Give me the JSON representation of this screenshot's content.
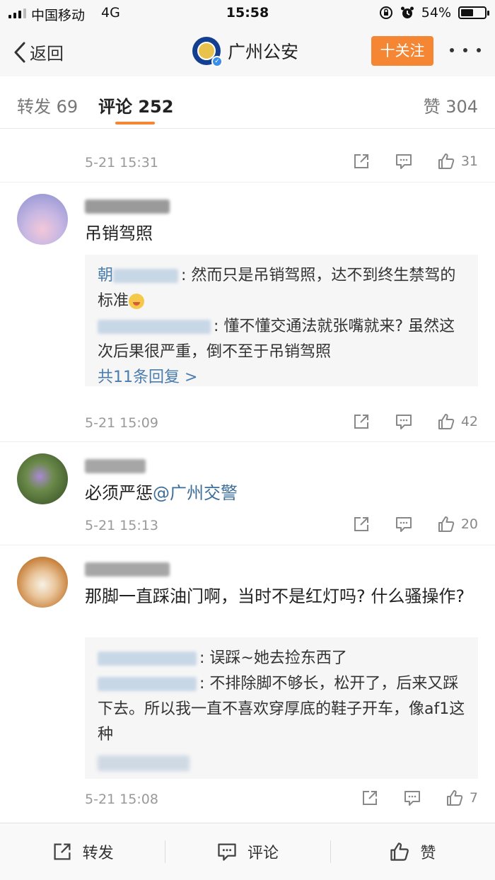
{
  "status_bar": {
    "carrier": "中国移动",
    "network": "4G",
    "time": "15:58",
    "battery": "54%",
    "battery_level": 0.54
  },
  "header": {
    "back_label": "返回",
    "account_name": "广州公安",
    "follow_label": "十关注"
  },
  "tabs": {
    "repost": "转发 69",
    "comments": "评论 252",
    "likes": "赞 304"
  },
  "comments": [
    {
      "time": "5-21 15:31",
      "likes": "31"
    },
    {
      "text": "吊销驾照",
      "replies": [
        {
          "name": "朝",
          "text": ": 然而只是吊销驾照，达不到终生禁驾的标准"
        },
        {
          "text": ": 懂不懂交通法就张嘴就来? 虽然这次后果很严重，倒不至于吊销驾照"
        }
      ],
      "more_replies": "共11条回复 >",
      "time": "5-21 15:09",
      "likes": "42"
    },
    {
      "text": "必须严惩",
      "mention": "@广州交警",
      "time": "5-21 15:13",
      "likes": "20"
    },
    {
      "text": "那脚一直踩油门啊，当时不是红灯吗? 什么骚操作?",
      "replies": [
        {
          "text": ": 误踩~她去捡东西了"
        },
        {
          "text": ": 不排除脚不够长，松开了，后来又踩下去。所以我一直不喜欢穿厚底的鞋子开车，像af1这种"
        }
      ],
      "time": "5-21 15:08",
      "likes": "7"
    }
  ],
  "bottom_bar": {
    "repost": "转发",
    "comment": "评论",
    "like": "赞"
  },
  "colors": {
    "accent": "#f58634",
    "link": "#3d6e99",
    "reply_bg": "#f6f6f6"
  }
}
